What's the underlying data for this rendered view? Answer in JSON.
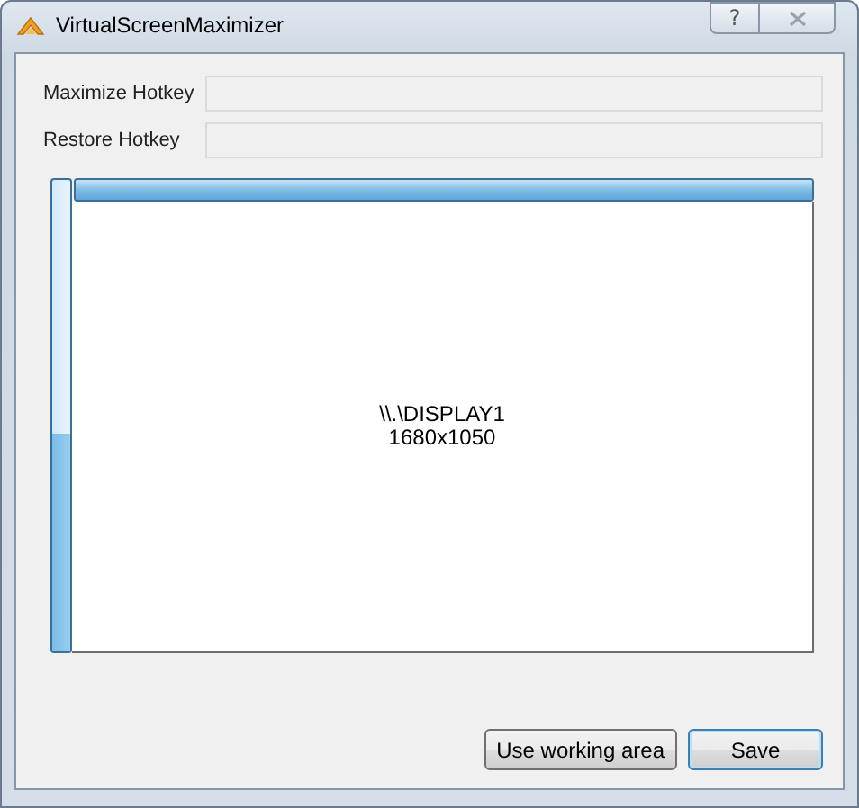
{
  "window": {
    "title": "VirtualScreenMaximizer",
    "help_button": "?"
  },
  "hotkeys": [
    {
      "label": "Maximize Hotkey"
    },
    {
      "label": "Restore Hotkey"
    }
  ],
  "horizontal_bar": {
    "level": 1
  },
  "vertical_bar": {
    "level": 0.46
  },
  "display": {
    "name": "\\\\.\\DISPLAY1",
    "resolution": "1680x1050"
  },
  "buttons": [
    {
      "label": "Use working area",
      "default": false
    },
    {
      "label": "Save",
      "default": true
    }
  ]
}
